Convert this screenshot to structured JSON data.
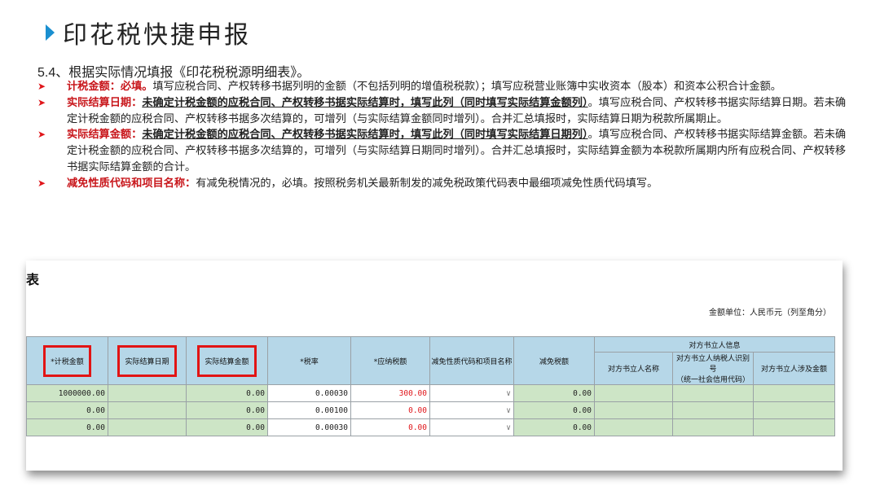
{
  "slide": {
    "title": "印花税快捷申报",
    "subtitle": "5.4、根据实际情况填报《印花税税源明细表》。",
    "bullets": [
      {
        "label": "计税金额：必填。",
        "text": "填写应税合同、产权转移书据列明的金额（不包括列明的增值税税款）；填写应税营业账簿中实收资本（股本）和资本公积合计金额。"
      },
      {
        "label": "实际结算日期：",
        "underline": "未确定计税金额的应税合同、产权转移书据实际结算时，填写此列（同时填写实际结算金额列）",
        "text": "。填写应税合同、产权转移书据实际结算日期。若未确定计税金额的应税合同、产权转移书据多次结算的，可增列（与实际结算金额同时增列）。合并汇总填报时，实际结算日期为税款所属期止。"
      },
      {
        "label": "实际结算金额：",
        "underline": "未确定计税金额的应税合同、产权转移书据实际结算时，填写此列（同时填写实际结算日期列）",
        "text": "。填写应税合同、产权转移书据实际结算金额。若未确定计税金额的应税合同、产权转移书据多次结算的，可增列（与实际结算日期同时增列）。合并汇总填报时，实际结算金额为本税款所属期内所有应税合同、产权转移书据实际结算金额的合计。"
      },
      {
        "label": "减免性质代码和项目名称：",
        "text": "有减免税情况的，必填。按照税务机关最新制发的减免税政策代码表中最细项减免性质代码填写。"
      }
    ]
  },
  "screenshot": {
    "title_fragment": "表",
    "unit_note": "金额单位：人民币元（列至角分）",
    "headers": {
      "taxable_amount": "*计税金额",
      "settle_date": "实际结算日期",
      "settle_amount": "实际结算金额",
      "tax_rate": "*税率",
      "tax_payable": "*应纳税额",
      "exemption_code": "减免性质代码和项目名称",
      "exempt_amount": "减免税额",
      "counterparty_group": "对方书立人信息",
      "cp_name": "对方书立人名称",
      "cp_id_1": "对方书立人纳税人识别号",
      "cp_id_2": "（统一社会信用代码）",
      "cp_amount": "对方书立人涉及金额"
    },
    "dropdown_glyph": "∨",
    "rows": [
      {
        "taxable": "1000000.00",
        "settle_date": "",
        "settle_amount": "0.00",
        "rate": "0.00030",
        "payable": "300.00",
        "exempt": "0.00"
      },
      {
        "taxable": "0.00",
        "settle_date": "",
        "settle_amount": "0.00",
        "rate": "0.00100",
        "payable": "0.00",
        "exempt": "0.00"
      },
      {
        "taxable": "0.00",
        "settle_date": "",
        "settle_amount": "0.00",
        "rate": "0.00030",
        "payable": "0.00",
        "exempt": "0.00"
      }
    ]
  }
}
